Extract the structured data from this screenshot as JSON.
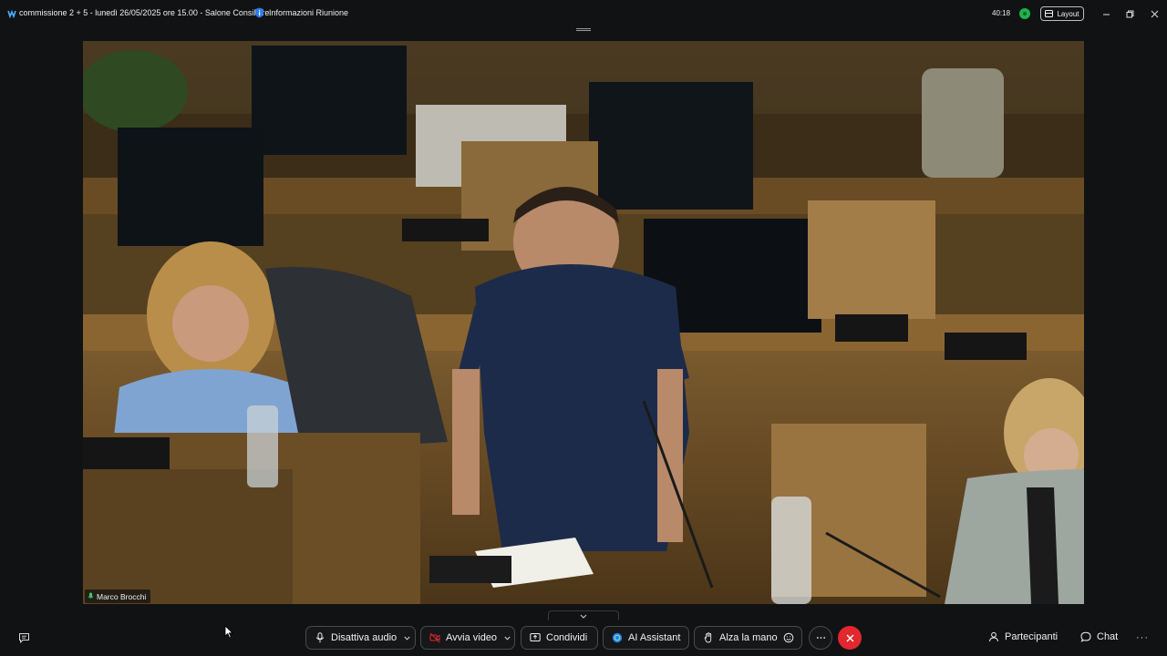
{
  "titlebar": {
    "meeting_title": "commissione 2 + 5 - lunedì 26/05/2025 ore 15.00 - Salone Consiliare",
    "info_label": "Informazioni Riunione",
    "timer": "40:18",
    "layout_label": "Layout"
  },
  "video": {
    "speaker_name": "Marco Brocchi"
  },
  "toolbar": {
    "audio_label": "Disattiva audio",
    "video_label": "Avvia video",
    "share_label": "Condividi",
    "ai_label": "AI Assistant",
    "raise_hand_label": "Alza la mano",
    "participants_label": "Partecipanti",
    "chat_label": "Chat",
    "more_right": "···"
  },
  "colors": {
    "background": "#111214",
    "end_call": "#e0282e",
    "status_green": "#1fb24a",
    "video_off_red": "#e0282e"
  },
  "icons": [
    "webex-logo-icon",
    "info-shield-icon",
    "status-icon",
    "layout-icon",
    "minimize-icon",
    "restore-icon",
    "close-icon",
    "microphone-icon",
    "video-off-icon",
    "share-icon",
    "ai-assistant-icon",
    "raise-hand-icon",
    "reactions-icon",
    "more-icon",
    "end-call-icon",
    "participants-icon",
    "chat-icon",
    "captions-icon"
  ]
}
